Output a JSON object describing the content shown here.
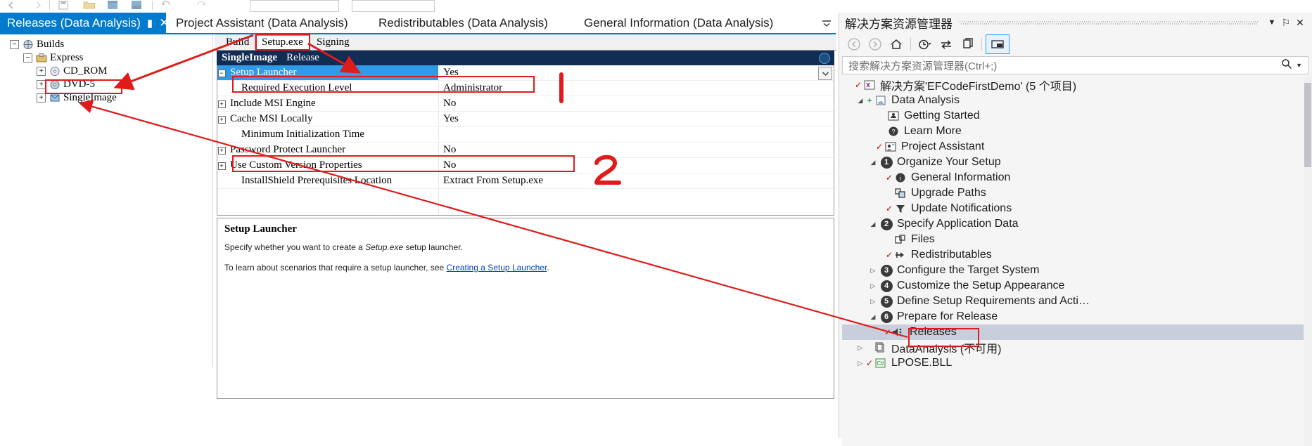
{
  "toolbar": {
    "icons": [
      "back-icon",
      "forward-icon",
      "save-icon",
      "open-folder-icon",
      "window-icon",
      "window2-icon",
      "undo-icon",
      "redo-icon"
    ],
    "combo1_value": "",
    "combo2_value": ""
  },
  "document_tabs": [
    {
      "label": "Releases (Data Analysis)",
      "active": true,
      "pin": "▮",
      "close": "✕"
    },
    {
      "label": "Project Assistant (Data Analysis)",
      "active": false
    },
    {
      "label": "Redistributables (Data Analysis)",
      "active": false
    },
    {
      "label": "General Information (Data Analysis)",
      "active": false
    }
  ],
  "tabbar_overflow_icon": "chevron-down-icon",
  "left_tree": [
    {
      "label": "Builds",
      "indent": 0,
      "expander": "−",
      "icon": "builds-icon"
    },
    {
      "label": "Express",
      "indent": 1,
      "expander": "−",
      "icon": "express-icon"
    },
    {
      "label": "CD_ROM",
      "indent": 2,
      "expander": "+",
      "icon": "cdrom-icon"
    },
    {
      "label": "DVD-5",
      "indent": 2,
      "expander": "+",
      "icon": "dvd-icon"
    },
    {
      "label": "SingleImage",
      "indent": 2,
      "expander": "+",
      "icon": "singleimage-icon",
      "highlighted": true
    }
  ],
  "inner_tabs": [
    {
      "label": "Build",
      "selected": false
    },
    {
      "label": "Setup.exe",
      "selected": true
    },
    {
      "label": "Signing",
      "selected": false
    }
  ],
  "grid_header": {
    "name": "SingleImage",
    "config": "Release",
    "icon": "help-circle-icon"
  },
  "grid_rows": [
    {
      "name": "Setup Launcher",
      "value": "Yes",
      "expander": "−",
      "selected": true,
      "indent": 0
    },
    {
      "name": "Required Execution Level",
      "value": "Administrator",
      "expander": "",
      "selected": false,
      "indent": 1
    },
    {
      "name": "Include MSI Engine",
      "value": "No",
      "expander": "+",
      "selected": false,
      "indent": 0
    },
    {
      "name": "Cache MSI Locally",
      "value": "Yes",
      "expander": "+",
      "selected": false,
      "indent": 0
    },
    {
      "name": "Minimum Initialization Time",
      "value": "",
      "expander": "",
      "selected": false,
      "indent": 1
    },
    {
      "name": "Password Protect Launcher",
      "value": "No",
      "expander": "+",
      "selected": false,
      "indent": 0
    },
    {
      "name": "Use Custom Version Properties",
      "value": "No",
      "expander": "+",
      "selected": false,
      "indent": 0
    },
    {
      "name": "InstallShield Prerequisites Location",
      "value": "Extract From Setup.exe",
      "expander": "",
      "selected": false,
      "indent": 1
    }
  ],
  "description": {
    "title": "Setup Launcher",
    "line1_pre": "Specify whether you want to create a ",
    "line1_em": "Setup.exe",
    "line1_post": " setup launcher.",
    "line2_pre": "To learn about scenarios that require a setup launcher, see ",
    "line2_link": "Creating a Setup Launcher",
    "line2_post": "."
  },
  "solution_explorer": {
    "title": "解决方案资源管理器",
    "window_buttons": [
      {
        "icon": "chevron-down-icon",
        "glyph": "▼"
      },
      {
        "icon": "pin-icon",
        "glyph": "⚐"
      },
      {
        "icon": "close-icon",
        "glyph": "✕"
      }
    ],
    "toolbar_buttons": [
      {
        "icon": "back-icon",
        "glyph": "◀",
        "disabled": true
      },
      {
        "icon": "forward-icon",
        "glyph": "▶",
        "disabled": true
      },
      {
        "icon": "home-icon",
        "glyph": "⌂",
        "disabled": false
      },
      {
        "icon": "pending-changes-icon",
        "glyph": "◔",
        "disabled": false
      },
      {
        "icon": "sync-icon",
        "glyph": "⇆",
        "disabled": false
      },
      {
        "icon": "refresh-icon",
        "glyph": "❐",
        "disabled": false
      },
      {
        "icon": "properties-icon",
        "glyph": "▬",
        "disabled": false,
        "boxed": true
      }
    ],
    "search_placeholder": "搜索解决方案资源管理器(Ctrl+;)",
    "search_value": "",
    "search_icon": "magnifier-icon",
    "search_dropdown_icon": "chevron-down-icon",
    "tree": [
      {
        "label": "解决方案'EFCodeFirstDemo' (5 个项目)",
        "indent": 0,
        "arrow": "",
        "check": "✓",
        "icon": "solution-icon"
      },
      {
        "label": "Data Analysis",
        "indent": 1,
        "arrow": "◢",
        "check": "+",
        "icon": "project-icon"
      },
      {
        "label": "Getting Started",
        "indent": 2,
        "arrow": "",
        "check": "",
        "icon": "getting-started-icon"
      },
      {
        "label": "Learn More",
        "indent": 2,
        "arrow": "",
        "check": "",
        "icon": "learn-more-icon"
      },
      {
        "label": "Project Assistant",
        "indent": 2,
        "arrow": "",
        "check": "✓",
        "icon": "project-assistant-icon"
      },
      {
        "label": "Organize Your Setup",
        "indent": 2,
        "arrow": "◢",
        "check": "",
        "icon": "num",
        "num": "1"
      },
      {
        "label": "General Information",
        "indent": 3,
        "arrow": "",
        "check": "✓",
        "icon": "info-icon"
      },
      {
        "label": "Upgrade Paths",
        "indent": 3,
        "arrow": "",
        "check": "",
        "icon": "upgrade-paths-icon"
      },
      {
        "label": "Update Notifications",
        "indent": 3,
        "arrow": "",
        "check": "✓",
        "icon": "update-notifications-icon"
      },
      {
        "label": "Specify Application Data",
        "indent": 2,
        "arrow": "◢",
        "check": "",
        "icon": "num",
        "num": "2"
      },
      {
        "label": "Files",
        "indent": 3,
        "arrow": "",
        "check": "",
        "icon": "files-icon"
      },
      {
        "label": "Redistributables",
        "indent": 3,
        "arrow": "",
        "check": "✓",
        "icon": "redistributables-icon"
      },
      {
        "label": "Configure the Target System",
        "indent": 2,
        "arrow": "▷",
        "check": "",
        "icon": "num",
        "num": "3"
      },
      {
        "label": "Customize the Setup Appearance",
        "indent": 2,
        "arrow": "▷",
        "check": "",
        "icon": "num",
        "num": "4"
      },
      {
        "label": "Define Setup Requirements and Acti…",
        "indent": 2,
        "arrow": "▷",
        "check": "",
        "icon": "num",
        "num": "5"
      },
      {
        "label": "Prepare for Release",
        "indent": 2,
        "arrow": "◢",
        "check": "",
        "icon": "num",
        "num": "6"
      },
      {
        "label": "Releases",
        "indent": 3,
        "arrow": "",
        "check": "✓",
        "icon": "releases-icon",
        "selected": true
      },
      {
        "label": "DataAnalysis (不可用)",
        "indent": 1,
        "arrow": "▷",
        "check": "",
        "icon": "unavailable-project-icon"
      },
      {
        "label": "LPOSE.BLL",
        "indent": 1,
        "arrow": "▷",
        "check": "✓",
        "icon": "csharp-project-icon"
      }
    ]
  },
  "annotations": {
    "color": "#e01b1b",
    "markers": [
      {
        "text": "1"
      },
      {
        "text": "2"
      }
    ],
    "boxes": [
      "setup-exe-tab-highlight",
      "required-execution-level-highlight",
      "prerequisites-location-highlight",
      "singleimage-node-highlight",
      "releases-node-highlight"
    ]
  }
}
